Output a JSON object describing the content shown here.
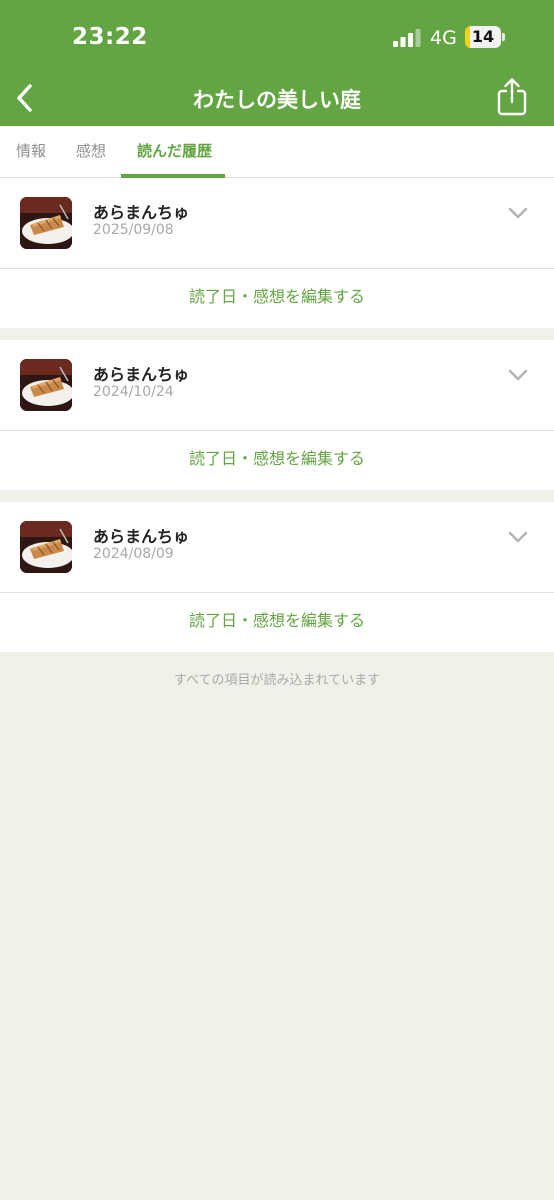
{
  "status_bar": {
    "time": "23:22",
    "network": "4G",
    "battery": "14",
    "battery_level": 0.14
  },
  "header": {
    "title": "わたしの美しい庭",
    "background_color": "#64a543"
  },
  "tabs": [
    {
      "label": "情報",
      "active": false
    },
    {
      "label": "感想",
      "active": false
    },
    {
      "label": "読んだ履歴",
      "active": true
    }
  ],
  "history": {
    "items": [
      {
        "name": "あらまんちゅ",
        "date": "2025/09/08",
        "edit_label": "読了日・感想を編集する"
      },
      {
        "name": "あらまんちゅ",
        "date": "2024/10/24",
        "edit_label": "読了日・感想を編集する"
      },
      {
        "name": "あらまんちゅ",
        "date": "2024/08/09",
        "edit_label": "読了日・感想を編集する"
      }
    ]
  },
  "footer": {
    "message": "すべての項目が読み込まれています"
  },
  "colors": {
    "accent": "#64a543",
    "page_background": "#eef2e8"
  }
}
